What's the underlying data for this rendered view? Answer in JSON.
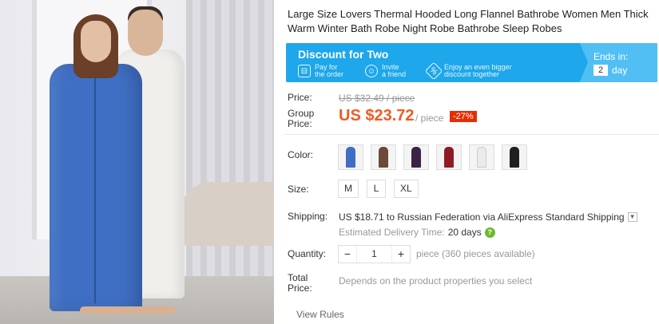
{
  "product": {
    "title": "Large Size Lovers Thermal Hooded Long Flannel Bathrobe Women Men Thick Warm Winter Bath Robe Night Robe Bathrobe Sleep Robes"
  },
  "banner": {
    "heading": "Discount for Two",
    "steps": [
      {
        "icon": "price-tag-icon",
        "line1": "Pay for",
        "line2": "the order"
      },
      {
        "icon": "person-add-icon",
        "line1": "Invite",
        "line2": "a friend"
      },
      {
        "icon": "coupon-icon",
        "line1": "Enjoy an even bigger",
        "line2": "discount together"
      }
    ],
    "ends_label": "Ends in:",
    "days_value": "2",
    "days_word": "day",
    "color": "#1ea7ea"
  },
  "price": {
    "price_label": "Price:",
    "old_price": "US $32.49 / piece",
    "group_label_1": "Group",
    "group_label_2": "Price:",
    "group_price": "US $23.72",
    "per_piece": "/ piece",
    "discount": "-27%",
    "accent_color": "#f05a23"
  },
  "color": {
    "label": "Color:",
    "options": [
      {
        "name": "blue",
        "swatch": "#3f6fc4"
      },
      {
        "name": "brown",
        "swatch": "#6b4a3a"
      },
      {
        "name": "purple",
        "swatch": "#3a2346"
      },
      {
        "name": "red",
        "swatch": "#8e1b24"
      },
      {
        "name": "white",
        "swatch": "#ecebe8"
      },
      {
        "name": "black",
        "swatch": "#1f1f22"
      }
    ]
  },
  "size": {
    "label": "Size:",
    "options": [
      "M",
      "L",
      "XL"
    ]
  },
  "shipping": {
    "label": "Shipping:",
    "text": "US $18.71 to Russian Federation via AliExpress Standard Shipping",
    "delivery_label": "Estimated Delivery Time:",
    "delivery_days": "20 days",
    "help_icon": "?"
  },
  "quantity": {
    "label": "Quantity:",
    "minus": "−",
    "value": "1",
    "plus": "+",
    "note": "piece (360 pieces available)"
  },
  "total": {
    "label_1": "Total",
    "label_2": "Price:",
    "note": "Depends on the product properties you select"
  },
  "footer": {
    "view_rules": "View Rules"
  }
}
